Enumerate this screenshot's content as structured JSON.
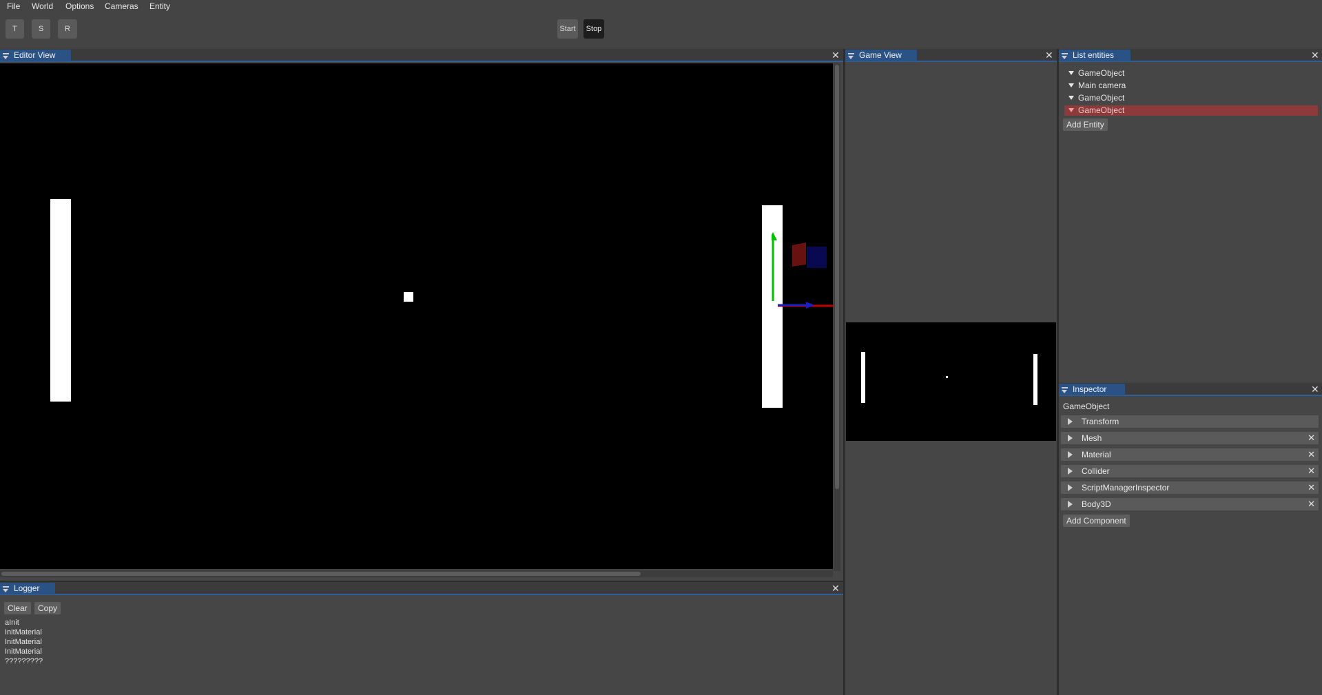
{
  "menu": {
    "items": [
      "File",
      "World",
      "Options",
      "Cameras",
      "Entity"
    ]
  },
  "toolbar": {
    "transform_modes": [
      "T",
      "S",
      "R"
    ],
    "start_label": "Start",
    "stop_label": "Stop"
  },
  "editor_view": {
    "tab_label": "Editor View",
    "close_symbol": "✕"
  },
  "game_view": {
    "tab_label": "Game View",
    "close_symbol": "✕"
  },
  "list_entities": {
    "tab_label": "List entities",
    "close_symbol": "✕",
    "items": [
      {
        "label": "GameObject",
        "selected": false
      },
      {
        "label": "Main camera",
        "selected": false
      },
      {
        "label": "GameObject",
        "selected": false
      },
      {
        "label": "GameObject",
        "selected": true
      }
    ],
    "add_button": "Add Entity"
  },
  "inspector": {
    "tab_label": "Inspector",
    "close_symbol": "✕",
    "entity_name": "GameObject",
    "components": [
      {
        "label": "Transform",
        "removable": false
      },
      {
        "label": "Mesh",
        "removable": true
      },
      {
        "label": "Material",
        "removable": true
      },
      {
        "label": "Collider",
        "removable": true
      },
      {
        "label": "ScriptManagerInspector",
        "removable": true
      },
      {
        "label": "Body3D",
        "removable": true
      }
    ],
    "add_button": "Add Component"
  },
  "logger": {
    "tab_label": "Logger",
    "close_symbol": "✕",
    "clear_label": "Clear",
    "copy_label": "Copy",
    "lines": [
      "aInit",
      "InitMaterial",
      "InitMaterial",
      "InitMaterial",
      "?????????"
    ]
  },
  "colors": {
    "background": "#434343",
    "tab_active": "#2b5285",
    "selected_row": "#8c3a3a",
    "gizmo_y": "#00c000",
    "gizmo_x": "#c00000",
    "gizmo_z": "#1f1fbf"
  }
}
